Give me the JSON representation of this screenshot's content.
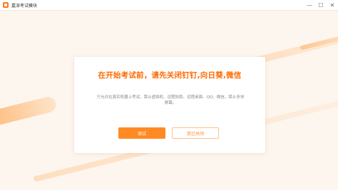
{
  "window": {
    "title": "嘉深考试模块",
    "controls": {
      "minimize": "—",
      "maximize": "☐",
      "close": "✕"
    }
  },
  "dialog": {
    "headline": "在开始考试前，请先关闭钉钉,向日葵,微信",
    "description": "只允许在真实机器上考试，禁止虚拟机、远程协助、远程桌面、QQ、微信，禁止多块屏幕。",
    "start_button": "测试",
    "closed_button": "我已关闭"
  },
  "colors": {
    "accent": "#ff8a24",
    "headline": "#ff6a00",
    "background": "#fdf6ee"
  }
}
